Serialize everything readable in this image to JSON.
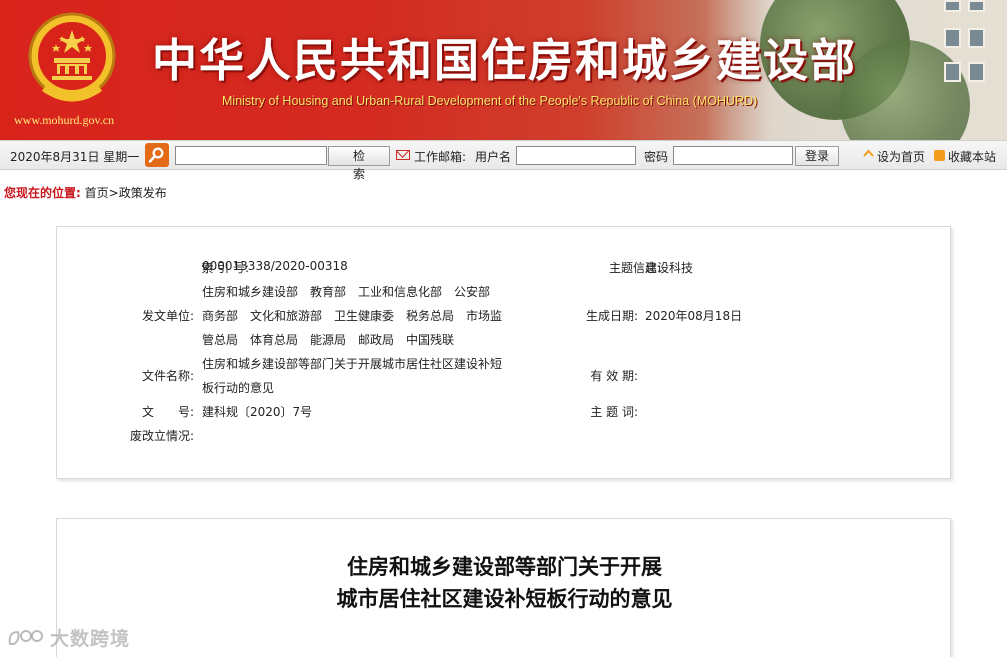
{
  "banner": {
    "title_cn": "中华人民共和国住房和城乡建设部",
    "title_en": "Ministry of Housing and Urban-Rural Development of the People's Republic of China (MOHURD)",
    "url": "www.mohurd.gov.cn",
    "emblem_icon": "national-emblem-icon"
  },
  "toolbar": {
    "date": "2020年8月31日 星期一",
    "search_placeholder": "",
    "search_button": "检索",
    "mail_label": "工作邮箱:",
    "username_label": "用户名",
    "username_value": "",
    "password_label": "密码",
    "password_value": "",
    "login_button": "登录",
    "set_home": "设为首页",
    "bookmark": "收藏本站"
  },
  "breadcrumb": {
    "label": "您现在的位置:",
    "items": [
      "首页",
      ">",
      "政策发布"
    ]
  },
  "info": {
    "index_label": "索 引 号:",
    "index_value": "000013338/2020-00318",
    "topic_label": "主题信息:",
    "topic_value": "建设科技",
    "issuer_label": "发文单位:",
    "issuer_lines": [
      "住房和城乡建设部　教育部　工业和信息化部　公安部",
      "商务部　文化和旅游部　卫生健康委　税务总局　市场监",
      "管总局　体育总局　能源局　邮政局　中国残联"
    ],
    "date_label": "生成日期:",
    "date_value": "2020年08月18日",
    "filename_label": "文件名称:",
    "filename_lines": [
      "住房和城乡建设部等部门关于开展城市居住社区建设补短",
      "板行动的意见"
    ],
    "validity_label": "有 效 期:",
    "validity_value": "",
    "docno_label": "文　　号:",
    "docno_value": "建科规〔2020〕7号",
    "keywords_label": "主 题 词:",
    "keywords_value": "",
    "status_label": "废改立情况:",
    "status_value": ""
  },
  "document": {
    "title_line1": "住房和城乡建设部等部门关于开展",
    "title_line2": "城市居住社区建设补短板行动的意见"
  },
  "watermark": {
    "text": "大数跨境"
  },
  "colors": {
    "banner_red": "#d8231b",
    "breadcrumb_red": "#c8161d",
    "search_orange": "#e36a17"
  }
}
